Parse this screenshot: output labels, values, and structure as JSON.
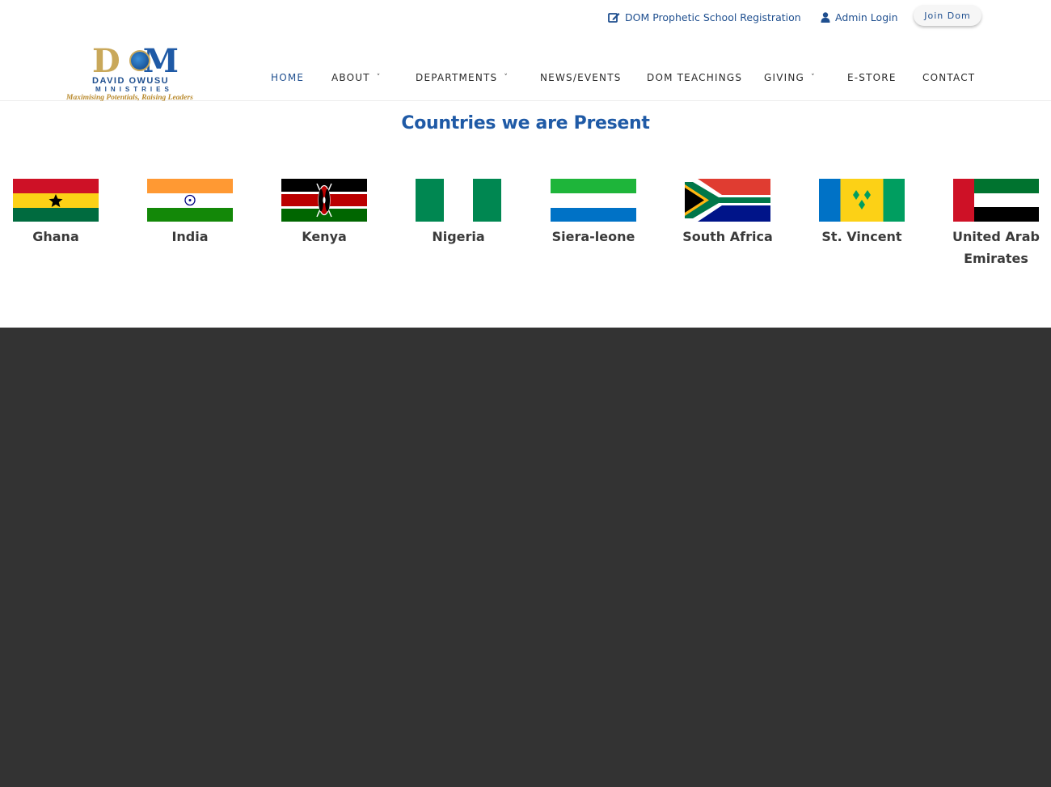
{
  "topbar": {
    "registration_label": "DOM Prophetic School Registration",
    "admin_label": "Admin Login",
    "join_label": "Join Dom"
  },
  "logo": {
    "monogram_left": "D",
    "monogram_right": "M",
    "name": "DAVID OWUSU",
    "sub": "MINISTRIES",
    "tagline": "Maximising Potentials, Raising Leaders"
  },
  "nav": {
    "items": [
      {
        "label": "HOME",
        "dropdown": false,
        "active": true
      },
      {
        "label": "ABOUT",
        "dropdown": true
      },
      {
        "label": "DEPARTMENTS",
        "dropdown": true
      },
      {
        "label": "NEWS/EVENTS",
        "dropdown": false
      },
      {
        "label": "DOM TEACHINGS",
        "dropdown": false
      },
      {
        "label": "GIVING",
        "dropdown": true
      },
      {
        "label": "E-STORE",
        "dropdown": false
      },
      {
        "label": "CONTACT",
        "dropdown": false
      }
    ],
    "chevron": "˅"
  },
  "section": {
    "title": "Countries we are Present",
    "countries": [
      {
        "name": "Ghana"
      },
      {
        "name": "India"
      },
      {
        "name": "Kenya"
      },
      {
        "name": "Nigeria"
      },
      {
        "name": "Siera-leone"
      },
      {
        "name": "South Africa"
      },
      {
        "name": "St. Vincent"
      },
      {
        "name": "United Arab Emirates"
      }
    ]
  },
  "colors": {
    "brand_blue": "#1f5aa6",
    "gold": "#c9a85a",
    "footer": "#333333"
  },
  "icons": {
    "registration": "edit-icon",
    "admin": "user-icon",
    "dropdown": "chevron-down-icon"
  }
}
